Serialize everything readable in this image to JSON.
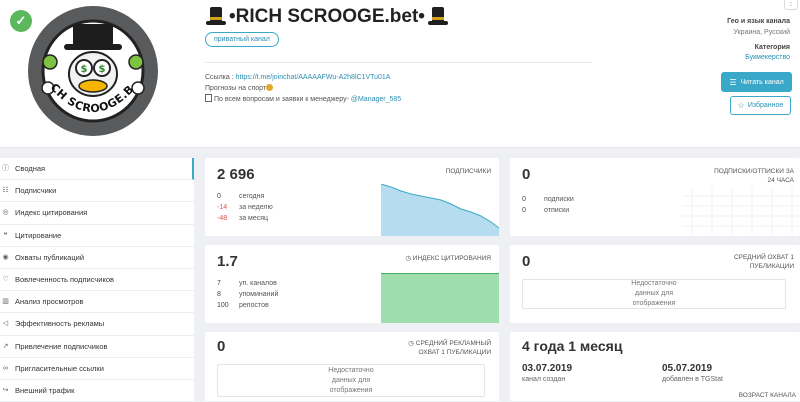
{
  "channel": {
    "title": "•RICH SCROOGE.bet•",
    "avatar_text": "RICH SCROOGE.BET",
    "tag": "приватный канал",
    "link_label": "Ссылка : ",
    "link_url": "https://t.me/joinchat/AAAAAFWu-A2h8lC1VTu01A",
    "line2": "Прогнозы на спорт",
    "line3_prefix": "По всем вопросам и заявки к менеджеру- ",
    "line3_handle": "@Manager_585",
    "geo_label": "Гео и язык канала",
    "geo_value": "Украина, Русский",
    "category_label": "Категория",
    "category_value": "Букмекерство",
    "read_button": "Читать канал",
    "fav_button": "Избранное"
  },
  "sidebar": {
    "items": [
      {
        "label": "Сводная",
        "icon": "info-icon"
      },
      {
        "label": "Подписчики",
        "icon": "users-icon"
      },
      {
        "label": "Индекс цитирования",
        "icon": "target-icon"
      },
      {
        "label": "Цитирование",
        "icon": "quote-icon"
      },
      {
        "label": "Охваты публикаций",
        "icon": "eye-icon"
      },
      {
        "label": "Вовлеченность подписчиков",
        "icon": "heart-icon"
      },
      {
        "label": "Анализ просмотров",
        "icon": "chart-icon"
      },
      {
        "label": "Эффективность рекламы",
        "icon": "megaphone-icon"
      },
      {
        "label": "Привлечение подписчиков",
        "icon": "trend-icon"
      },
      {
        "label": "Пригласительные ссылки",
        "icon": "link-icon"
      },
      {
        "label": "Внешний трафик",
        "icon": "arrow-icon"
      }
    ]
  },
  "subscribers": {
    "value": "2 696",
    "label": "подписчики",
    "rows": [
      {
        "n": "0",
        "t": "сегодня"
      },
      {
        "n": "-14",
        "t": "за неделю"
      },
      {
        "n": "-48",
        "t": "за месяц"
      }
    ]
  },
  "subs_unsubs": {
    "value": "0",
    "label": "подписки/отписки за 24 часа",
    "rows": [
      {
        "n": "0",
        "t": "подписки"
      },
      {
        "n": "0",
        "t": "отписки"
      }
    ]
  },
  "citation": {
    "value": "1.7",
    "label": "индекс цитирования",
    "rows": [
      {
        "n": "7",
        "t": "уп. каналов"
      },
      {
        "n": "8",
        "t": "упоминаний"
      },
      {
        "n": "100",
        "t": "репостов"
      }
    ]
  },
  "reach": {
    "value": "0",
    "label": "средний охват 1 публикации",
    "nodata": "Недостаточно данных для отображения"
  },
  "ad_reach": {
    "value": "0",
    "label": "средний рекламный охват 1 публикации",
    "nodata": "Недостаточно данных для отображения"
  },
  "age": {
    "value": "4 года 1 месяц",
    "created_date": "03.07.2019",
    "created_label": "канал создан",
    "added_date": "05.07.2019",
    "added_label": "добавлен в TGStat",
    "label": "возраст канала"
  },
  "colors": {
    "accent": "#3aa9c9",
    "negative": "#d9534f",
    "verified": "#5cb85c",
    "chart_blue": "#b6dcef",
    "chart_green": "#9fdcae"
  }
}
